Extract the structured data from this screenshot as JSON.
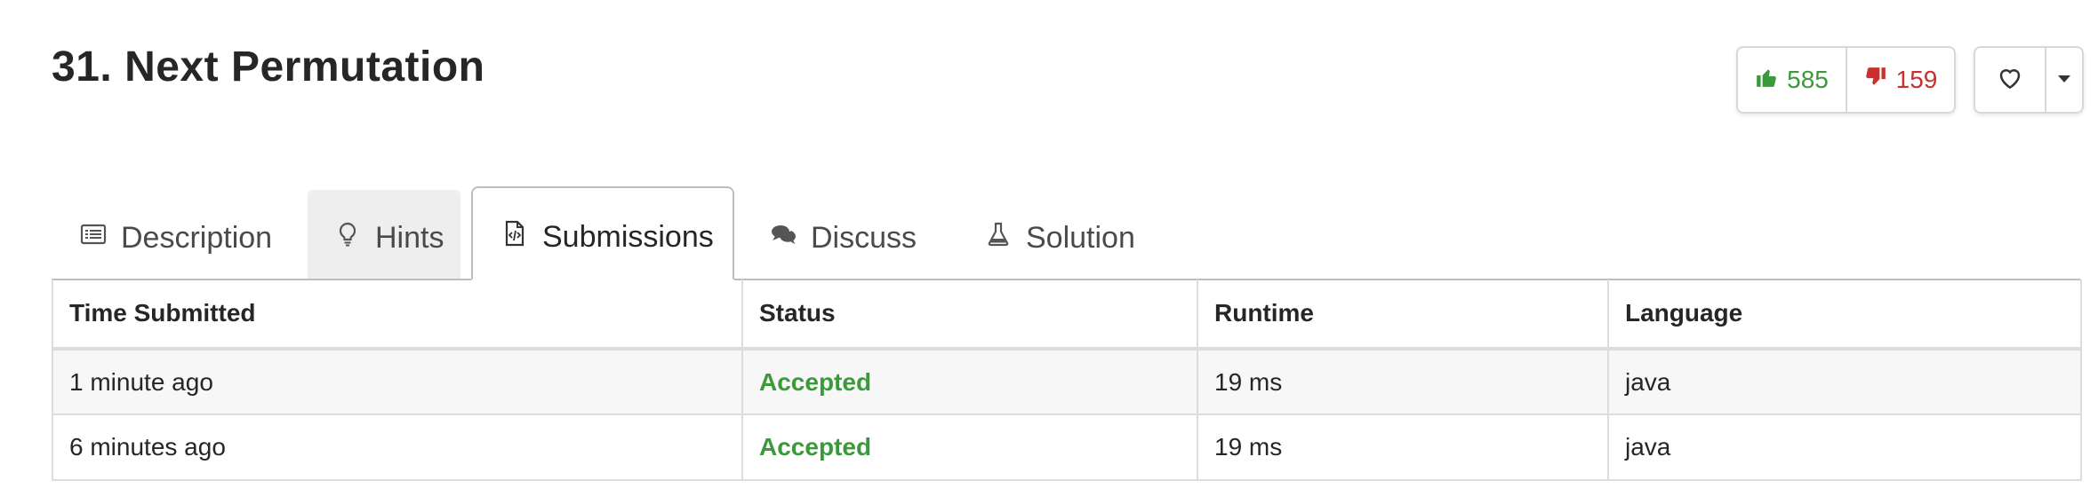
{
  "problem": {
    "title": "31. Next Permutation"
  },
  "votes": {
    "likes": "585",
    "dislikes": "159",
    "like_color": "#3a9a3a",
    "dislike_color": "#c9302c",
    "like_icon": "thumbs-up-icon",
    "dislike_icon": "thumbs-down-icon"
  },
  "favorite": {
    "icon": "heart-icon",
    "dropdown_icon": "caret-down-icon"
  },
  "tabs": [
    {
      "label": "Description",
      "icon": "list-icon",
      "active": false
    },
    {
      "label": "Hints",
      "icon": "lightbulb-icon",
      "active": false
    },
    {
      "label": "Submissions",
      "icon": "code-file-icon",
      "active": true
    },
    {
      "label": "Discuss",
      "icon": "comments-icon",
      "active": false
    },
    {
      "label": "Solution",
      "icon": "flask-icon",
      "active": false
    }
  ],
  "submissions": {
    "columns": [
      "Time Submitted",
      "Status",
      "Runtime",
      "Language"
    ],
    "rows": [
      {
        "time": "1 minute ago",
        "status": "Accepted",
        "runtime": "19 ms",
        "language": "java"
      },
      {
        "time": "6 minutes ago",
        "status": "Accepted",
        "runtime": "19 ms",
        "language": "java"
      }
    ],
    "accepted_color": "#3a9a3a"
  }
}
